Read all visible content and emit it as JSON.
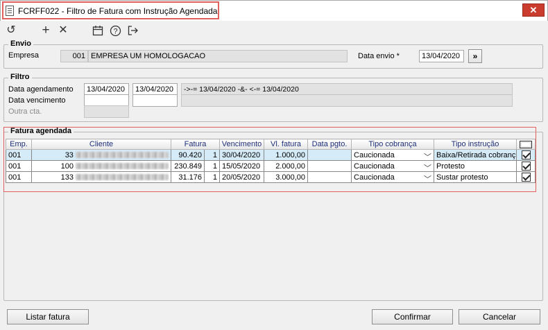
{
  "window": {
    "title": "FCRFF022 - Filtro de Fatura com Instrução Agendada",
    "close_glyph": "✕"
  },
  "toolbar": [
    {
      "name": "undo",
      "glyph": "↺"
    },
    {
      "name": "add",
      "glyph": "+"
    },
    {
      "name": "delete",
      "glyph": "✕"
    },
    {
      "name": "calendar",
      "glyph": "📅"
    },
    {
      "name": "help",
      "glyph": "?"
    },
    {
      "name": "exit",
      "glyph": "↦"
    }
  ],
  "envio": {
    "legend": "Envio",
    "empresa_label": "Empresa",
    "empresa_code": "001",
    "empresa_name": "EMPRESA UM  HOMOLOGACAO",
    "data_envio_label": "Data envio *",
    "data_envio_value": "13/04/2020",
    "go_button": "»"
  },
  "filtro": {
    "legend": "Filtro",
    "data_agendamento_label": "Data agendamento",
    "data_agendamento_from": "13/04/2020",
    "data_agendamento_to": "13/04/2020",
    "data_agendamento_expr": "->-= 13/04/2020  -&- <-= 13/04/2020",
    "data_vencimento_label": "Data vencimento",
    "data_vencimento_from": "",
    "data_vencimento_to": "",
    "outra_cta_label": "Outra cta."
  },
  "fatura": {
    "legend": "Fatura agendada",
    "columns": [
      "Emp.",
      "Cliente",
      "Fatura",
      "Vencimento",
      "Vl. fatura",
      "Data pgto.",
      "Tipo cobrança",
      "Tipo instrução"
    ],
    "rows": [
      {
        "emp": "001",
        "cliente_code": "33",
        "fatura": "90.420",
        "parcela": "1",
        "vencimento": "30/04/2020",
        "valor": "1.000,00",
        "data_pgto": "",
        "tipo_cobranca": "Caucionada",
        "tipo_instrucao": "Baixa/Retirada cobranç",
        "checked": true
      },
      {
        "emp": "001",
        "cliente_code": "100",
        "fatura": "230.849",
        "parcela": "1",
        "vencimento": "15/05/2020",
        "valor": "2.000,00",
        "data_pgto": "",
        "tipo_cobranca": "Caucionada",
        "tipo_instrucao": "Protesto",
        "checked": true
      },
      {
        "emp": "001",
        "cliente_code": "133",
        "fatura": "31.176",
        "parcela": "1",
        "vencimento": "20/05/2020",
        "valor": "3.000,00",
        "data_pgto": "",
        "tipo_cobranca": "Caucionada",
        "tipo_instrucao": "Sustar protesto",
        "checked": true
      }
    ]
  },
  "footer": {
    "listar_fatura": "Listar fatura",
    "confirmar": "Confirmar",
    "cancelar": "Cancelar"
  },
  "colors": {
    "highlight": "#e06060",
    "header_text": "#1f2f7a",
    "selected_row": "#d6ebf8",
    "close_button": "#c93c2e"
  }
}
